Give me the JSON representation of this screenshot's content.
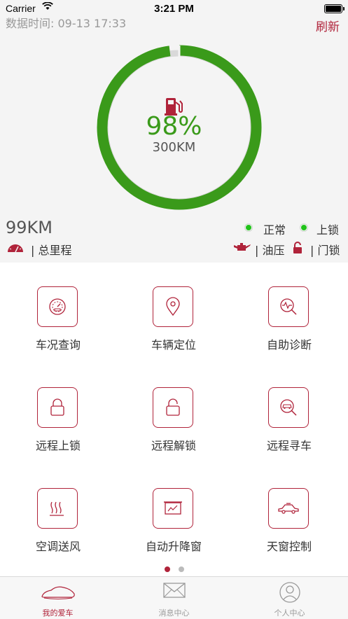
{
  "status_bar": {
    "carrier": "Carrier",
    "time": "3:21 PM"
  },
  "header": {
    "data_time": "数据时间: 09-13 17:33",
    "refresh_label": "刷新"
  },
  "fuel": {
    "percent_text": "98%",
    "range_text": "300KM",
    "level": 0.98
  },
  "odometer": {
    "value": "99KM",
    "label": "| 总里程"
  },
  "indicators": {
    "status": {
      "value": "正常",
      "label": "| 油压"
    },
    "lock": {
      "value": "上锁",
      "label": "| 门锁"
    }
  },
  "grid": [
    {
      "label": "车况查询",
      "icon": "gauge-icon"
    },
    {
      "label": "车辆定位",
      "icon": "location-pin-icon"
    },
    {
      "label": "自助诊断",
      "icon": "diagnosis-icon"
    },
    {
      "label": "远程上锁",
      "icon": "lock-icon"
    },
    {
      "label": "远程解锁",
      "icon": "unlock-icon"
    },
    {
      "label": "远程寻车",
      "icon": "find-car-icon"
    },
    {
      "label": "空调送风",
      "icon": "air-flow-icon"
    },
    {
      "label": "自动升降窗",
      "icon": "window-icon"
    },
    {
      "label": "天窗控制",
      "icon": "sunroof-icon"
    }
  ],
  "pager": {
    "pages": 2,
    "current": 1
  },
  "tabbar": [
    {
      "label": "我的爱车",
      "icon": "car-icon",
      "active": true
    },
    {
      "label": "消息中心",
      "icon": "mail-icon",
      "active": false
    },
    {
      "label": "个人中心",
      "icon": "person-icon",
      "active": false
    }
  ],
  "colors": {
    "accent": "#b0233a",
    "gauge_green": "#3a9a1a",
    "status_green": "#21c21a",
    "gauge_track": "#d9d9d9"
  }
}
